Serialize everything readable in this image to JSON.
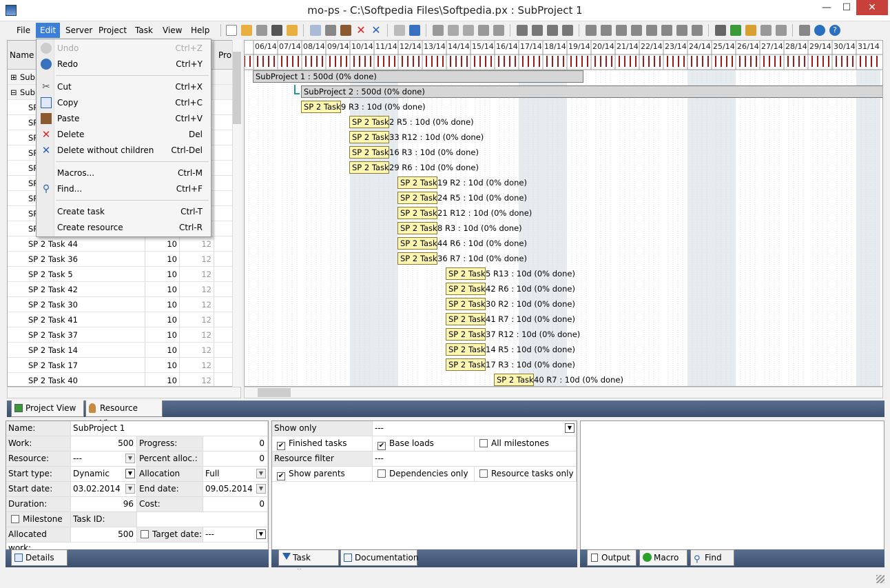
{
  "window": {
    "title": "mo-ps - C:\\Softpedia Files\\Softpedia.px : SubProject 1",
    "min": "—",
    "max": "☐",
    "close": "✕"
  },
  "menu": {
    "items": [
      "File",
      "Edit",
      "Server",
      "Project",
      "Task",
      "View",
      "Help"
    ],
    "active": "Edit"
  },
  "edit_menu": [
    {
      "label": "Undo",
      "shortcut": "Ctrl+Z",
      "disabled": true,
      "icon": "undo-icon"
    },
    {
      "label": "Redo",
      "shortcut": "Ctrl+Y",
      "disabled": false,
      "icon": "redo-icon"
    },
    {
      "label": "Cut",
      "shortcut": "Ctrl+X",
      "icon": "cut-icon"
    },
    {
      "label": "Copy",
      "shortcut": "Ctrl+C",
      "icon": "copy-icon"
    },
    {
      "label": "Paste",
      "shortcut": "Ctrl+V",
      "icon": "paste-icon"
    },
    {
      "label": "Delete",
      "shortcut": "Del",
      "icon": "delete-icon"
    },
    {
      "label": "Delete without children",
      "shortcut": "Ctrl-Del",
      "icon": "delete-children-icon"
    },
    {
      "label": "Macros...",
      "shortcut": "Ctrl-M",
      "icon": ""
    },
    {
      "label": "Find...",
      "shortcut": "Ctrl+F",
      "icon": "find-icon"
    },
    {
      "label": "Create task",
      "shortcut": "Ctrl-T",
      "icon": ""
    },
    {
      "label": "Create resource",
      "shortcut": "Ctrl-R",
      "icon": ""
    }
  ],
  "grid": {
    "headers": {
      "name": "Name",
      "pro": "Pro"
    },
    "group_rows": [
      {
        "label": "SubP"
      },
      {
        "label": "SubP"
      }
    ],
    "sp_rows": [
      "SP",
      "SP",
      "SP",
      "SP",
      "SP",
      "SP",
      "SP",
      "SP",
      "SP"
    ],
    "rows": [
      {
        "name": "SP 2 Task 44",
        "work": "10",
        "x": "12"
      },
      {
        "name": "SP 2 Task 36",
        "work": "10",
        "x": "12"
      },
      {
        "name": "SP 2 Task 5",
        "work": "10",
        "x": "12"
      },
      {
        "name": "SP 2 Task 42",
        "work": "10",
        "x": "12"
      },
      {
        "name": "SP 2 Task 30",
        "work": "10",
        "x": "12"
      },
      {
        "name": "SP 2 Task 41",
        "work": "10",
        "x": "12"
      },
      {
        "name": "SP 2 Task 37",
        "work": "10",
        "x": "12"
      },
      {
        "name": "SP 2 Task 14",
        "work": "10",
        "x": "12"
      },
      {
        "name": "SP 2 Task 17",
        "work": "10",
        "x": "12"
      },
      {
        "name": "SP 2 Task 40",
        "work": "10",
        "x": "12"
      }
    ]
  },
  "gantt": {
    "days": [
      "4",
      "06/14",
      "07/14",
      "08/14",
      "09/14",
      "10/14",
      "11/14",
      "12/14",
      "13/14",
      "14/14",
      "15/14",
      "16/14",
      "17/14",
      "18/14",
      "19/14",
      "20/14",
      "21/14",
      "22/14",
      "23/14",
      "24/14",
      "25/14",
      "26/14",
      "27/14",
      "28/14",
      "29/14",
      "30/14",
      "31/14"
    ],
    "subprojects": [
      {
        "label": "SubProject 1  : 500d (0% done)"
      },
      {
        "label": "SubProject 2  : 500d (0% done)"
      }
    ],
    "tasks": [
      {
        "bar": "SP 2 Task",
        "rest": "9 R3 : 10d (0% done)",
        "col": 0
      },
      {
        "bar": "SP 2 Task",
        "rest": "2 R5 : 10d (0% done)",
        "col": 1
      },
      {
        "bar": "SP 2 Task",
        "rest": "33 R12 : 10d (0% done)",
        "col": 1
      },
      {
        "bar": "SP 2 Task",
        "rest": "16 R3 : 10d (0% done)",
        "col": 1
      },
      {
        "bar": "SP 2 Task",
        "rest": "29 R6 : 10d (0% done)",
        "col": 1
      },
      {
        "bar": "SP 2 Task",
        "rest": "19 R2 : 10d (0% done)",
        "col": 2
      },
      {
        "bar": "SP 2 Task",
        "rest": "24 R5 : 10d (0% done)",
        "col": 2
      },
      {
        "bar": "SP 2 Task",
        "rest": "21 R12 : 10d (0% done)",
        "col": 2
      },
      {
        "bar": "SP 2 Task",
        "rest": "8 R3 : 10d (0% done)",
        "col": 2
      },
      {
        "bar": "SP 2 Task",
        "rest": "44 R6 : 10d (0% done)",
        "col": 2
      },
      {
        "bar": "SP 2 Task",
        "rest": "36 R7 : 10d (0% done)",
        "col": 2
      },
      {
        "bar": "SP 2 Task",
        "rest": "5 R13 : 10d (0% done)",
        "col": 3
      },
      {
        "bar": "SP 2 Task",
        "rest": "42 R6 : 10d (0% done)",
        "col": 3
      },
      {
        "bar": "SP 2 Task",
        "rest": "30 R2 : 10d (0% done)",
        "col": 3
      },
      {
        "bar": "SP 2 Task",
        "rest": "41 R7 : 10d (0% done)",
        "col": 3
      },
      {
        "bar": "SP 2 Task",
        "rest": "37 R12 : 10d (0% done)",
        "col": 3
      },
      {
        "bar": "SP 2 Task",
        "rest": "14 R5 : 10d (0% done)",
        "col": 3
      },
      {
        "bar": "SP 2 Task",
        "rest": "17 R3 : 10d (0% done)",
        "col": 3
      },
      {
        "bar": "SP 2 Task",
        "rest": "40 R7 : 10d (0% done)",
        "col": 4
      }
    ]
  },
  "view_tabs": {
    "project": "Project View",
    "resource": "Resource View"
  },
  "details": {
    "name_label": "Name:",
    "name_value": "SubProject 1",
    "work_label": "Work:",
    "work_value": "500",
    "progress_label": "Progress:",
    "progress_value": "0",
    "resource_label": "Resource:",
    "resource_value": "---",
    "percent_label": "Percent alloc.:",
    "percent_value": "0",
    "starttype_label": "Start type:",
    "starttype_value": "Dynamic",
    "alloctype_label": "Allocation type:",
    "alloctype_value": "Full",
    "startdate_label": "Start date:",
    "startdate_value": "03.02.2014",
    "enddate_label": "End date:",
    "enddate_value": "09.05.2014",
    "duration_label": "Duration:",
    "duration_value": "96",
    "cost_label": "Cost:",
    "cost_value": "0",
    "milestone_label": "Milestone",
    "taskid_label": "Task ID:",
    "allocwork_label": "Allocated work:",
    "allocwork_value": "500",
    "target_label": "Target date:",
    "target_value": "---",
    "tab": "Details"
  },
  "filter": {
    "showonly_label": "Show only",
    "showonly_value": "---",
    "finished": "Finished tasks",
    "baseloads": "Base loads",
    "allmilestones": "All milestones",
    "resfilter_label": "Resource filter",
    "resfilter_value": "---",
    "showparents": "Show parents",
    "deponly": "Dependencies only",
    "restasks": "Resource tasks only",
    "tab1": "Task Filter",
    "tab2": "Documentation"
  },
  "output": {
    "tab1": "Output",
    "tab2": "Macro",
    "tab3": "Find"
  },
  "colors": {
    "accent": "#3c7fd8",
    "task_bar": "#fff6b0",
    "close_btn": "#c7413a"
  }
}
